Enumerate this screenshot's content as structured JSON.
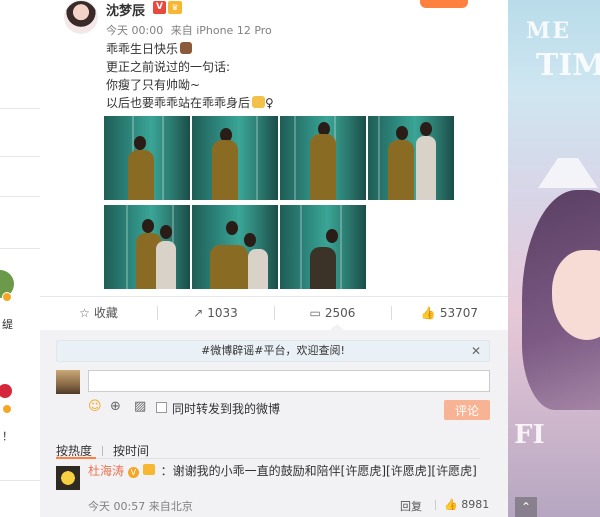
{
  "post": {
    "user_name": "沈梦辰",
    "vip_badge": "V",
    "time": "今天 00:00",
    "source": "来自 iPhone 12 Pro",
    "lines": [
      "乖乖生日快乐",
      "更正之前说过的一句话:",
      "你瘦了只有帅呦~",
      "以后也要乖乖站在乖乖身后",
      "♀"
    ]
  },
  "actions": {
    "favorite": "收藏",
    "forward": "1033",
    "comment": "2506",
    "like": "53707"
  },
  "icons": {
    "favorite": "☆",
    "forward": "↗",
    "comment": "▭",
    "like": "👍",
    "close": "✕",
    "scroll_top": "⌃",
    "emoji_tool": "☺",
    "gif_tool": "⊕",
    "image_tool": "▨"
  },
  "notice": {
    "text": "#微博辟谣#平台，欢迎查阅!"
  },
  "composer": {
    "input_value": "",
    "forward_label": "同时转发到我的微博",
    "submit_label": "评论"
  },
  "sort": {
    "hot": "按热度",
    "time": "按时间"
  },
  "comment": {
    "user": "杜海涛",
    "badge_v": "V",
    "text": "：谢谢我的小乖一直的鼓励和陪伴[许愿虎][许愿虎][许愿虎]",
    "time": "今天 00:57",
    "source": "来自北京",
    "reply_label": "回复",
    "likes": "8981"
  },
  "left_strip": {
    "snippet_1": "缇",
    "snippet_2": "！"
  },
  "colors": {
    "accent": "#ff8140",
    "name_link": "#eb7350",
    "submit_bg": "#f8b394",
    "teal_photo": "#2f8b80"
  }
}
